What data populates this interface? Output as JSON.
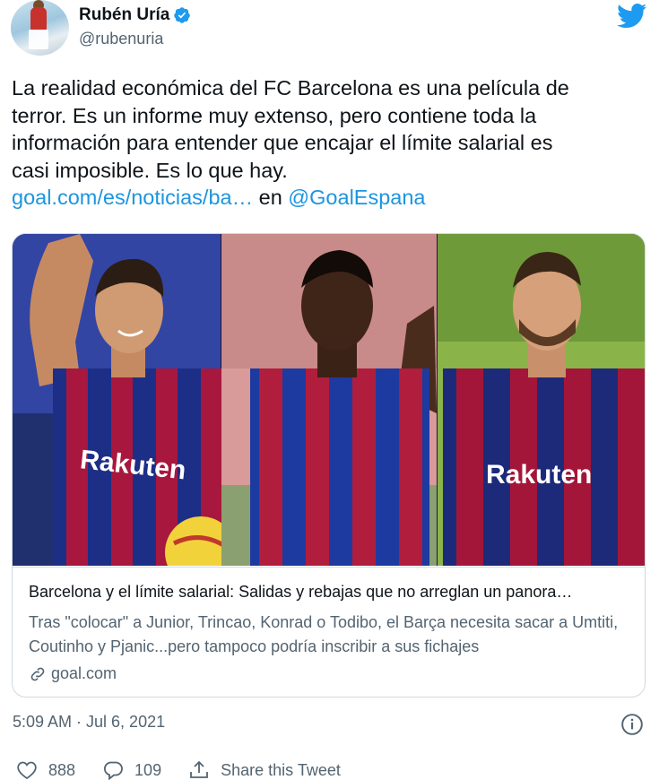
{
  "author": {
    "name": "Rubén Uría",
    "handle": "@rubenuria"
  },
  "tweet": {
    "lines": [
      "La realidad económica del FC Barcelona es una película de",
      "terror. Es un informe muy extenso, pero contiene toda la",
      "información para entender que encajar el límite salarial es",
      "casi imposible. Es lo que hay."
    ],
    "link_text": "goal.com/es/noticias/ba…",
    "link_connector": " en ",
    "mention": "@GoalEspana"
  },
  "card": {
    "image_text": "Rakuten",
    "title": "Barcelona y el límite salarial: Salidas y rebajas que no arreglan un panora…",
    "description": "Tras \"colocar\" a Junior, Trincao, Konrad o Todibo, el Barça necesita sacar a Umtiti, Coutinho y Pjanic...pero tampoco podría inscribir a sus fichajes",
    "domain": "goal.com"
  },
  "meta": {
    "timestamp": "5:09 AM · Jul 6, 2021"
  },
  "actions": {
    "likes": "888",
    "replies": "109",
    "share_label": "Share this Tweet"
  },
  "colors": {
    "link": "#1b95e0",
    "text": "#0f1419",
    "secondary": "#536471",
    "verified": "#1d9bf0",
    "twitter": "#1d9bf0"
  },
  "icons": [
    "verified-badge-icon",
    "twitter-bird-icon",
    "link-icon",
    "info-icon",
    "heart-icon",
    "reply-icon",
    "share-icon"
  ]
}
